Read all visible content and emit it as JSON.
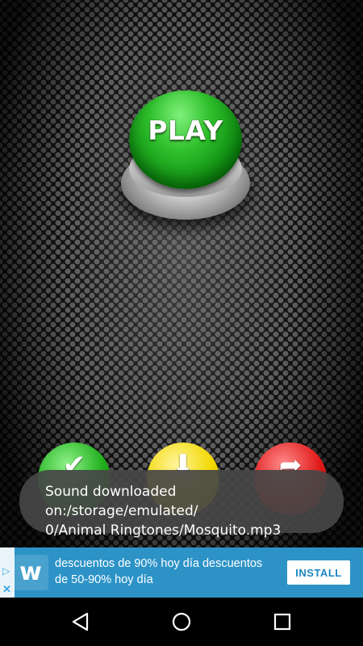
{
  "play_button": {
    "label": "PLAY",
    "color": "#1fae1b"
  },
  "action_buttons": [
    {
      "name": "confirm",
      "color": "#1fae1b",
      "icon": "check-icon",
      "glyph": "✔"
    },
    {
      "name": "download",
      "color": "#f1d800",
      "icon": "download-icon",
      "glyph": "⬇"
    },
    {
      "name": "share",
      "color": "#e01818",
      "icon": "share-icon",
      "glyph": "➦"
    }
  ],
  "toast": {
    "line1": "Sound downloaded on:/storage/emulated/",
    "line2": "0/Animal Ringtones/Mosquito.mp3"
  },
  "ad": {
    "line1": "descuentos de 90% hoy día descuentos",
    "line2": "de 50-90% hoy día",
    "install_label": "INSTALL",
    "logo_letter": "w",
    "icons": [
      "ad-choices-icon",
      "ad-close-icon"
    ],
    "background": "#2d93c7"
  },
  "nav": {
    "icons": [
      "back-icon",
      "home-icon",
      "recents-icon"
    ]
  }
}
